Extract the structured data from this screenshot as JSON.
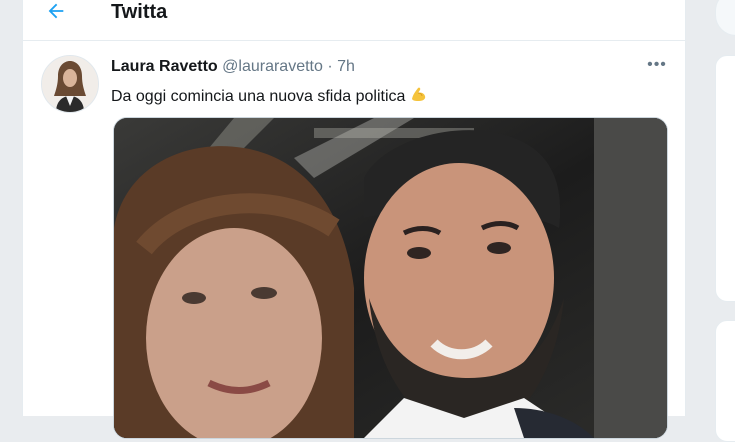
{
  "header": {
    "title": "Twitta",
    "back_icon": "arrow-left-icon"
  },
  "tweet": {
    "display_name": "Laura Ravetto",
    "handle": "@lauraravetto",
    "separator": "·",
    "time": "7h",
    "text": "Da oggi comincia una nuova sfida politica",
    "emoji_icon": "flexed-biceps-icon",
    "more_label": "•••"
  },
  "colors": {
    "accent": "#1da1f2",
    "text": "#14171a",
    "secondary": "#657786",
    "border": "#e6ecf0",
    "emoji": "#f5c33b"
  }
}
